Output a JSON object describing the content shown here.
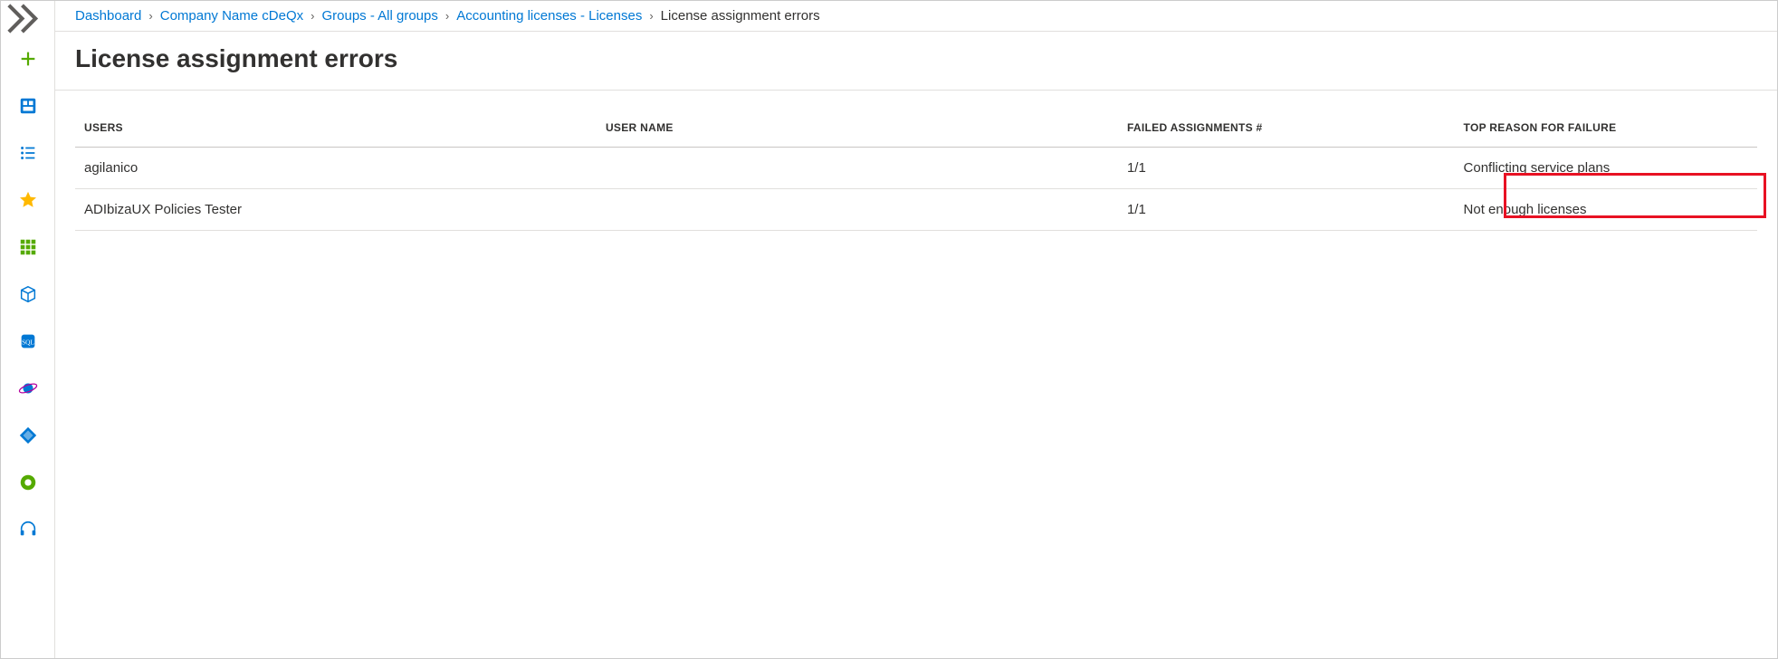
{
  "breadcrumb": {
    "items": [
      {
        "label": "Dashboard"
      },
      {
        "label": "Company Name cDeQx"
      },
      {
        "label": "Groups - All groups"
      },
      {
        "label": "Accounting licenses - Licenses"
      }
    ],
    "current": "License assignment errors"
  },
  "page": {
    "title": "License assignment errors"
  },
  "table": {
    "headers": {
      "users": "Users",
      "username": "User Name",
      "failed": "Failed Assignments #",
      "reason": "Top Reason for Failure"
    },
    "rows": [
      {
        "users": "agilanico",
        "username": "",
        "failed": "1/1",
        "reason": "Conflicting service plans"
      },
      {
        "users": "ADIbizaUX Policies Tester",
        "username": "",
        "failed": "1/1",
        "reason": "Not enough licenses"
      }
    ]
  },
  "rail": {
    "items": [
      "add-icon",
      "dashboard-icon",
      "list-icon",
      "star-icon",
      "grid-icon",
      "cube-icon",
      "sql-icon",
      "planet-icon",
      "diamond-icon",
      "circle-icon",
      "headset-icon"
    ]
  }
}
